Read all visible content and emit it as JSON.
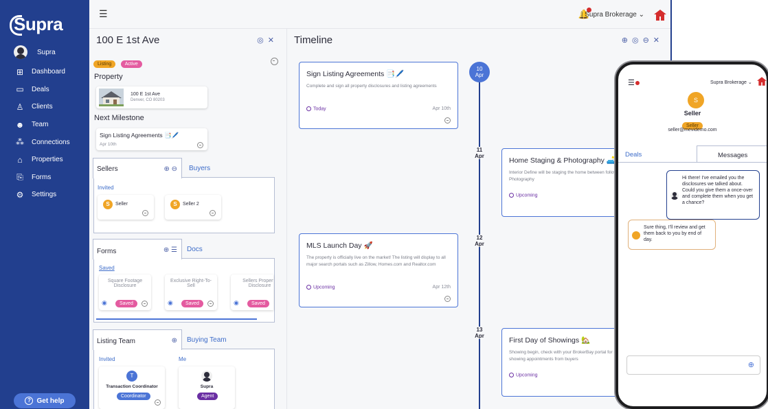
{
  "sidebar": {
    "logo": "Supra",
    "user": "Supra",
    "nav": [
      {
        "icon": "dashboard-icon",
        "glyph": "⊞",
        "label": "Dashboard"
      },
      {
        "icon": "deals-icon",
        "glyph": "▭",
        "label": "Deals"
      },
      {
        "icon": "clients-icon",
        "glyph": "♙",
        "label": "Clients"
      },
      {
        "icon": "team-icon",
        "glyph": "☻",
        "label": "Team"
      },
      {
        "icon": "connections-icon",
        "glyph": "⁂",
        "label": "Connections"
      },
      {
        "icon": "properties-icon",
        "glyph": "⌂",
        "label": "Properties"
      },
      {
        "icon": "forms-icon",
        "glyph": "⎘",
        "label": "Forms"
      },
      {
        "icon": "settings-icon",
        "glyph": "⚙",
        "label": "Settings"
      }
    ],
    "help": "Get help"
  },
  "topbar": {
    "brokerage": "Supra Brokerage"
  },
  "deal": {
    "title": "100 E 1st Ave",
    "tag_listing": "Listing",
    "tag_active": "Active",
    "property_label": "Property",
    "address_line1": "100 E 1st Ave",
    "address_line2": "Denver, CO 80203",
    "next_milestone_label": "Next Milestone",
    "milestone_title": "Sign Listing Agreements 📑🖊️",
    "milestone_date": "Apr 10th",
    "sellers_tab": "Sellers",
    "buyers_tab": "Buyers",
    "invited": "Invited",
    "seller1": "Seller",
    "seller2": "Seller 2",
    "forms_tab": "Forms",
    "docs_tab": "Docs",
    "saved": "Saved",
    "form1": "Square Footage Disclosure",
    "form2": "Exclusive Right-To-Sell",
    "form3": "Sellers Property Disclosure",
    "saved_badge": "Saved",
    "listing_team_tab": "Listing Team",
    "buying_team_tab": "Buying Team",
    "team_invited": "Invited",
    "team_me": "Me",
    "member1_initial": "T",
    "member1_name": "Transaction Coordinator",
    "member1_role": "Coordinator",
    "member2_name": "Supra",
    "member2_role": "Agent"
  },
  "timeline": {
    "title": "Timeline",
    "dates": [
      {
        "day": "10",
        "month": "Apr"
      },
      {
        "day": "11",
        "month": "Apr"
      },
      {
        "day": "12",
        "month": "Apr"
      },
      {
        "day": "13",
        "month": "Apr"
      }
    ],
    "cards": [
      {
        "title": "Sign Listing Agreements 📑🖊️",
        "desc": "Complete and sign all property disclosures and listing agreements",
        "status": "Today",
        "date": "Apr 10th"
      },
      {
        "title": "Home Staging & Photography 🛋️",
        "desc": "Interior Define will be staging the home between followed by BH Photography",
        "status": "Upcoming",
        "date": ""
      },
      {
        "title": "MLS Launch Day 🚀",
        "desc": "The property is officially live on the market! The listing will display to all major search portals such as Zillow, Homes.com and Realtor.com",
        "status": "Upcoming",
        "date": "Apr 12th"
      },
      {
        "title": "First Day of Showings 🏡",
        "desc": "Showing begin, check with your BrokerBay portal for updates on showing appointments from buyers",
        "status": "Upcoming",
        "date": ""
      }
    ]
  },
  "phone": {
    "brokerage": "Supra Brokerage",
    "avatar_initial": "S",
    "name": "Seller",
    "role": "Seller",
    "email": "seller@mevidemo.com",
    "tab_deals": "Deals",
    "tab_messages": "Messages",
    "msg_in": "Hi there! I've emailed you the disclosures we talked about. Could you give them a once-over and complete them when you get a chance?",
    "msg_out": "Sure thing, I'll review and get them back to you by end of day."
  },
  "colors": {
    "sidebar": "#223f8e",
    "accent": "#4b74d6",
    "pink": "#e45ba0",
    "orange": "#f0a526",
    "purple": "#6a2fa3"
  }
}
